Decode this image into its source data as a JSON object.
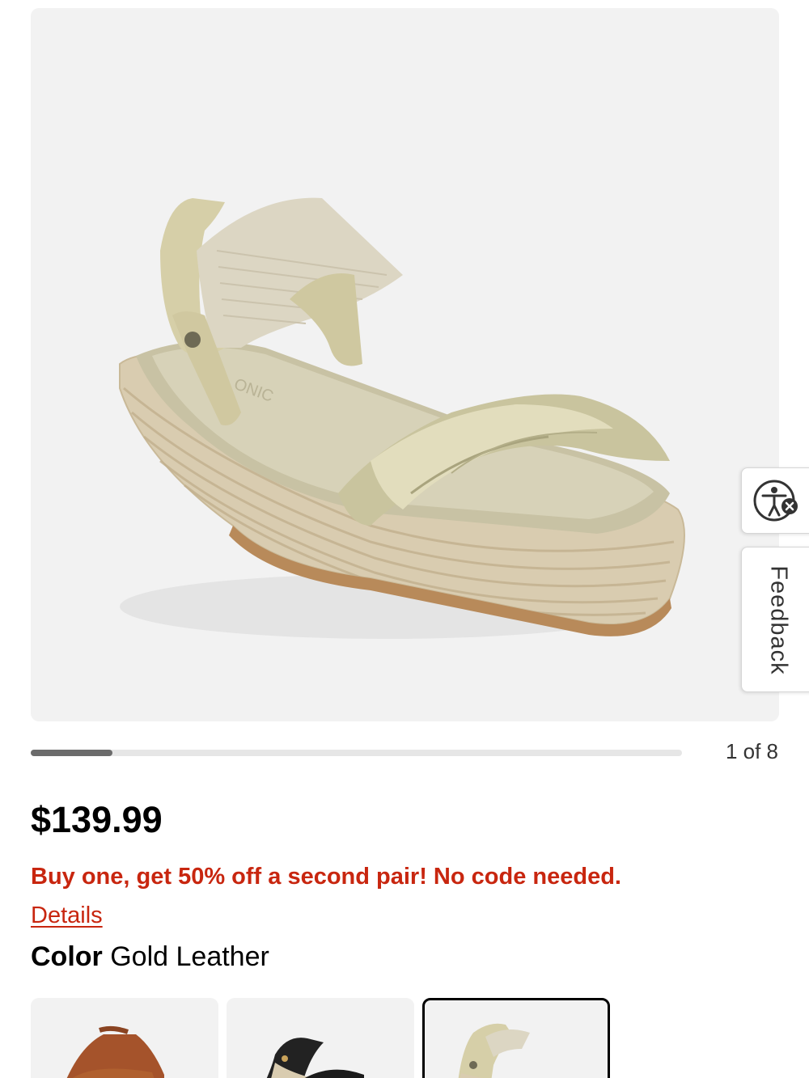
{
  "gallery": {
    "image_alt": "Gold leather espadrille wedge sandal",
    "brand_imprint": "ONIC",
    "progress": 0.125,
    "counter": "1 of 8"
  },
  "product": {
    "price": "$139.99",
    "promo": "Buy one, get 50% off a second pair! No code needed.",
    "details_link": "Details",
    "color_label": "Color",
    "color_value": "Gold Leather"
  },
  "swatches": [
    {
      "name": "Tan",
      "selected": false
    },
    {
      "name": "Black",
      "selected": false
    },
    {
      "name": "Gold Leather",
      "selected": true
    }
  ],
  "widgets": {
    "accessibility_icon": "accessibility-icon",
    "feedback_label": "Feedback"
  },
  "colors": {
    "promo_red": "#c8260f",
    "image_bg": "#f2f2f2",
    "progress_fill": "#6b6b6b",
    "progress_track": "#e6e6e6"
  }
}
